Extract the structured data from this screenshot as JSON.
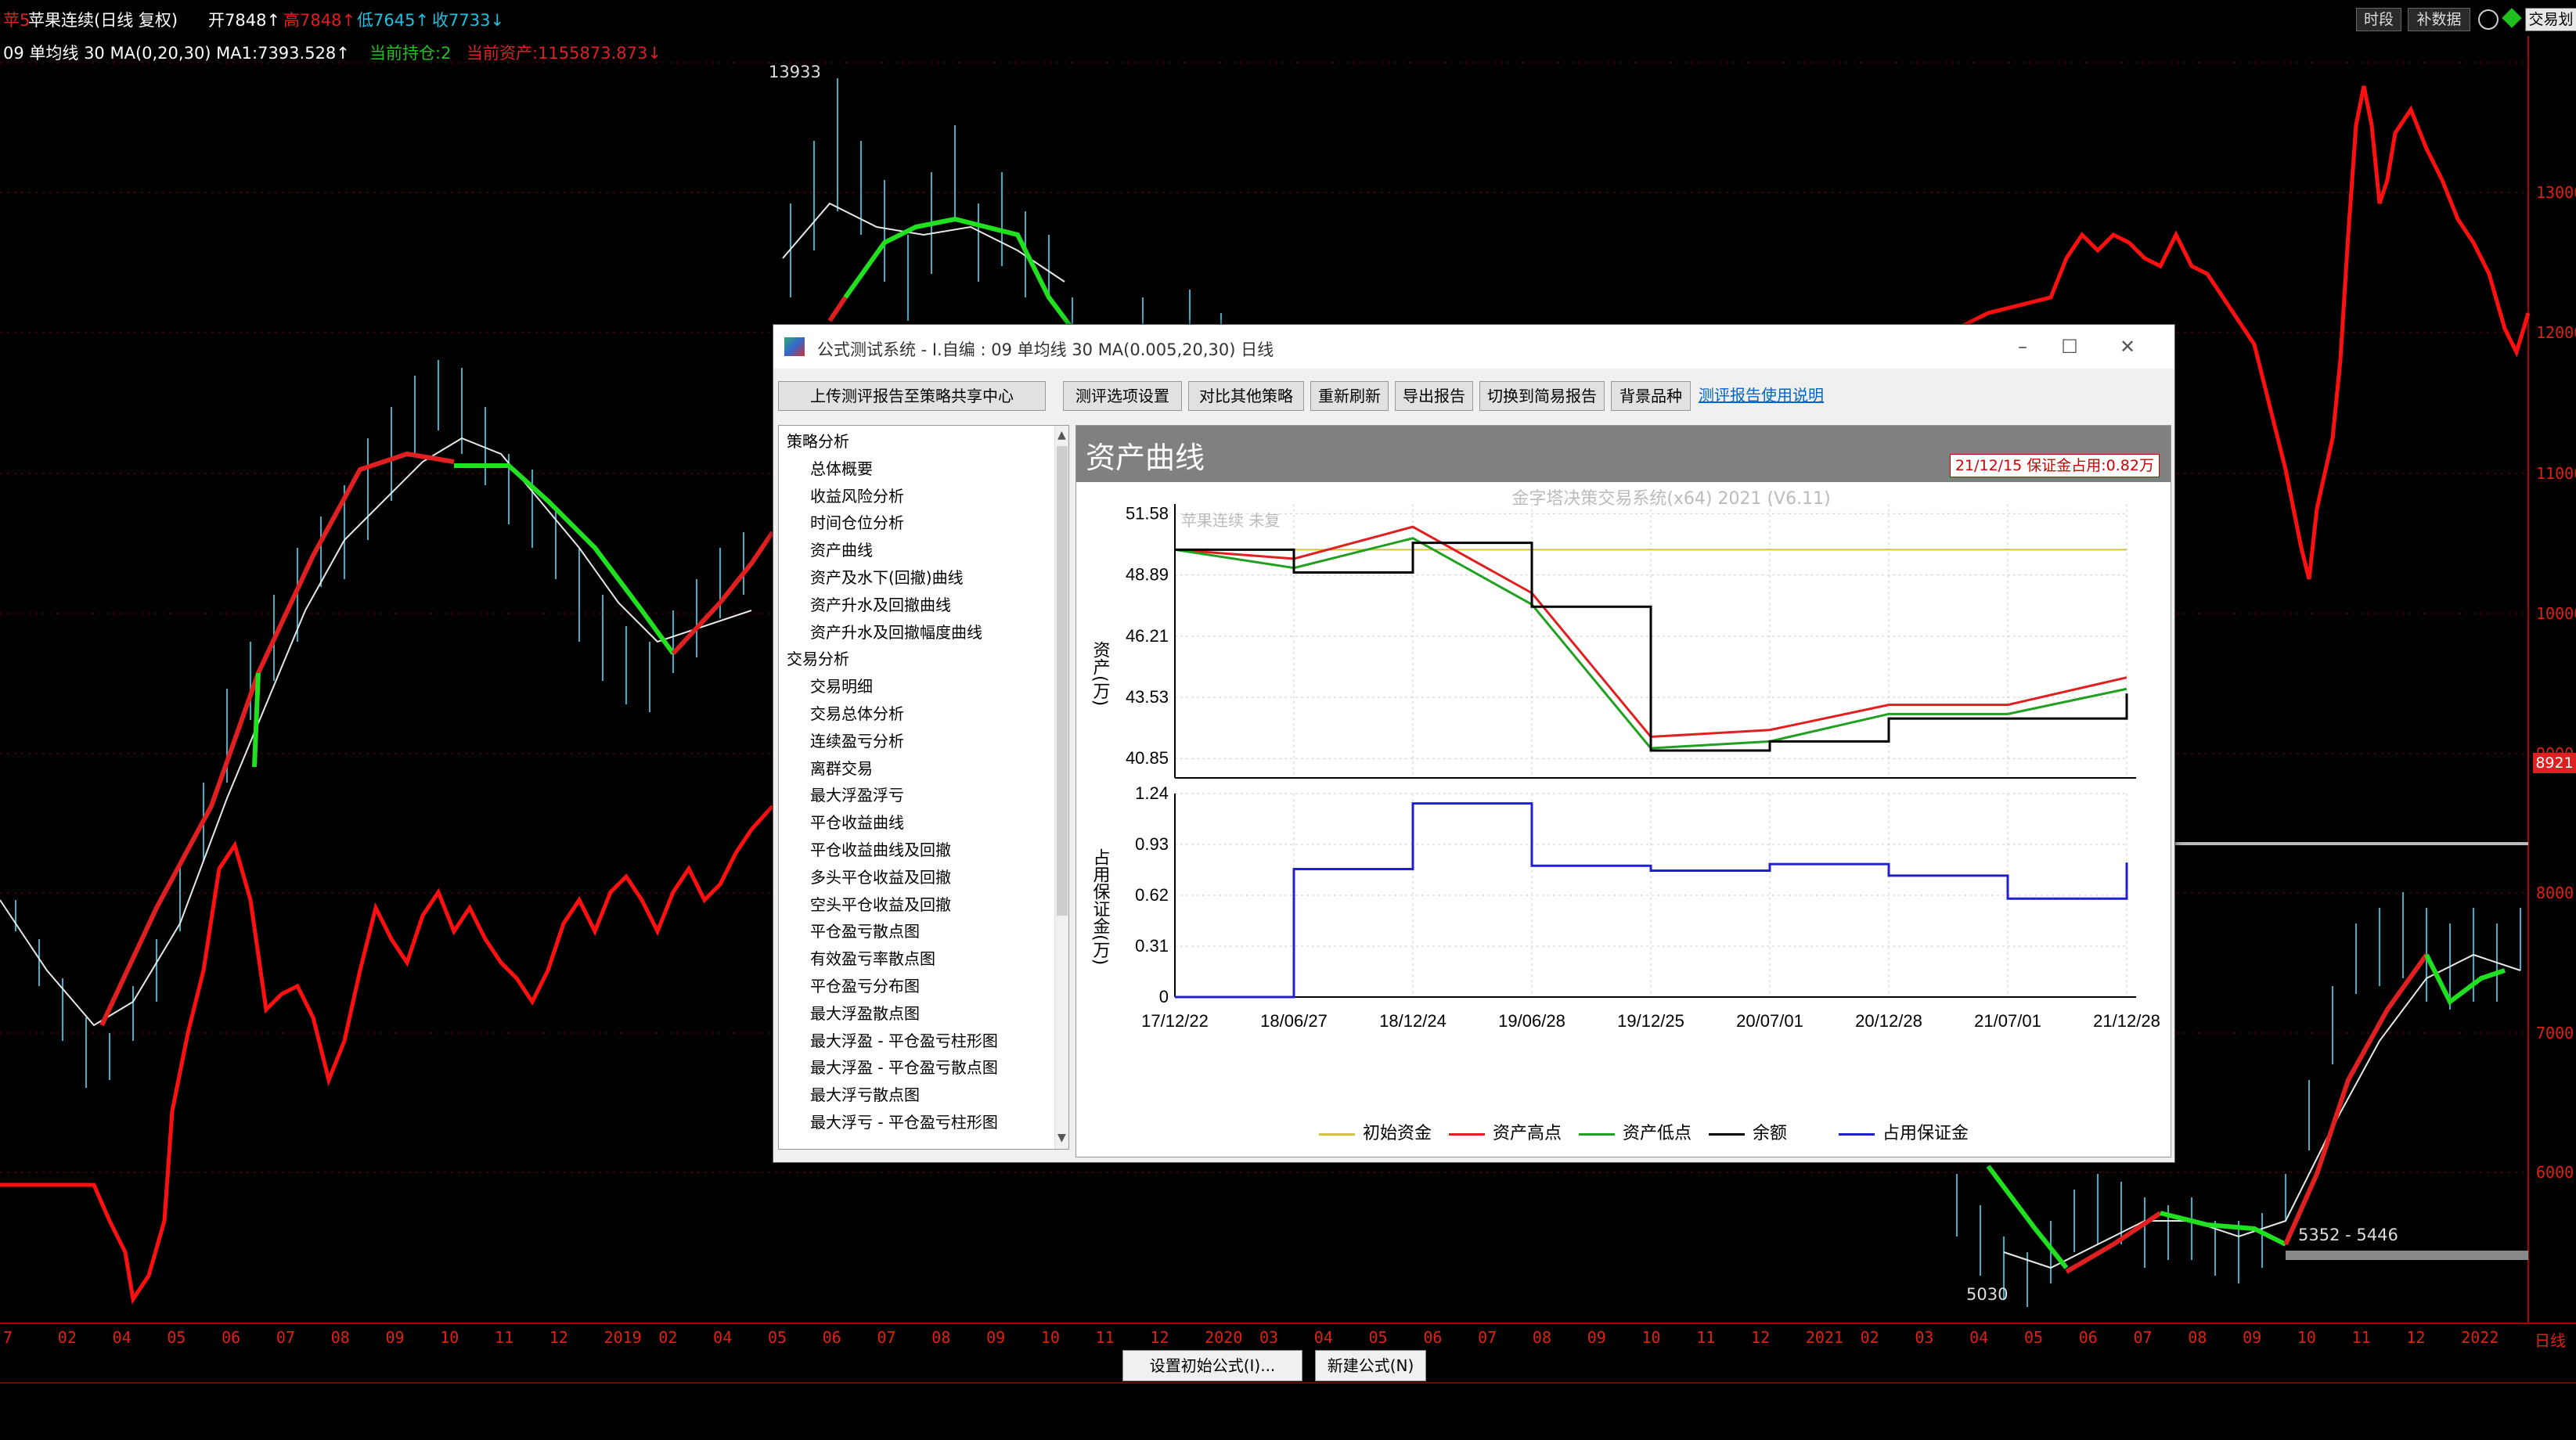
{
  "header": {
    "code": "苹5",
    "name": "苹果连续(日线 复权)",
    "open": "开7848↑",
    "high": "高7848↑",
    "low": "低7645↑",
    "close": "收7733↓",
    "btn_history": "时段",
    "btn_fill": "补数据",
    "btn_trade": "交易划"
  },
  "indicator_line": {
    "formula": "09 单均线 30 MA(0,20,30) MA1:7393.528↑",
    "position": "当前持仓:2",
    "assets": "当前资产:1155873.873↓"
  },
  "main_chart": {
    "high_label": "13933",
    "low_label": "5030",
    "range_label": "5352 - 5446",
    "last_price": "8921",
    "y_ticks": [
      "13000",
      "12000",
      "11000",
      "10000",
      "9000",
      "8000",
      "7000",
      "6000"
    ],
    "x_ticks": [
      "7",
      "02",
      "04",
      "05",
      "06",
      "07",
      "08",
      "09",
      "10",
      "11",
      "12",
      "2019",
      "02",
      "04",
      "05",
      "06",
      "07",
      "08",
      "09",
      "10",
      "11",
      "12",
      "2020",
      "03",
      "04",
      "05",
      "06",
      "07",
      "08",
      "09",
      "10",
      "11",
      "12",
      "2021",
      "02",
      "03",
      "04",
      "05",
      "06",
      "07",
      "08",
      "09",
      "10",
      "11",
      "12",
      "2022"
    ],
    "period": "日线"
  },
  "bottom": {
    "btn_set_initial": "设置初始公式(I)...",
    "btn_new_formula": "新建公式(N)"
  },
  "dialog": {
    "title": "公式测试系统 - I.自编 : 09 单均线 30 MA(0.005,20,30) 日线",
    "btn_upload": "上传测评报告至策略共享中心",
    "btn_options": "测评选项设置",
    "btn_compare": "对比其他策略",
    "btn_refresh": "重新刷新",
    "btn_export": "导出报告",
    "btn_simple": "切换到简易报告",
    "btn_background": "背景品种",
    "link_help": "测评报告使用说明",
    "tree": [
      {
        "label": "策略分析",
        "level": 0
      },
      {
        "label": "总体概要",
        "level": 1
      },
      {
        "label": "收益风险分析",
        "level": 1
      },
      {
        "label": "时间仓位分析",
        "level": 1
      },
      {
        "label": "资产曲线",
        "level": 1
      },
      {
        "label": "资产及水下(回撤)曲线",
        "level": 1
      },
      {
        "label": "资产升水及回撤曲线",
        "level": 1
      },
      {
        "label": "资产升水及回撤幅度曲线",
        "level": 1
      },
      {
        "label": "交易分析",
        "level": 0
      },
      {
        "label": "交易明细",
        "level": 1
      },
      {
        "label": "交易总体分析",
        "level": 1
      },
      {
        "label": "连续盈亏分析",
        "level": 1
      },
      {
        "label": "离群交易",
        "level": 1
      },
      {
        "label": "最大浮盈浮亏",
        "level": 1
      },
      {
        "label": "平仓收益曲线",
        "level": 1
      },
      {
        "label": "平仓收益曲线及回撤",
        "level": 1
      },
      {
        "label": "多头平仓收益及回撤",
        "level": 1
      },
      {
        "label": "空头平仓收益及回撤",
        "level": 1
      },
      {
        "label": "平仓盈亏散点图",
        "level": 1
      },
      {
        "label": "有效盈亏率散点图",
        "level": 1
      },
      {
        "label": "平仓盈亏分布图",
        "level": 1
      },
      {
        "label": "最大浮盈散点图",
        "level": 1
      },
      {
        "label": "最大浮盈 - 平仓盈亏柱形图",
        "level": 1
      },
      {
        "label": "最大浮盈 - 平仓盈亏散点图",
        "level": 1
      },
      {
        "label": "最大浮亏散点图",
        "level": 1
      },
      {
        "label": "最大浮亏 - 平仓盈亏柱形图",
        "level": 1
      }
    ],
    "panel_title": "资产曲线",
    "margin_badge": "21/12/15 保证金占用:0.82万",
    "watermark": "金字塔决策交易系统(x64) 2021 (V6.11)",
    "bg_symbol": "苹果连续 未复",
    "upper_ylabel": "资产(万)",
    "lower_ylabel": "占用保证金(万)",
    "legend": [
      {
        "label": "初始资金",
        "color": "#d8c040"
      },
      {
        "label": "资产高点",
        "color": "#e02020"
      },
      {
        "label": "资产低点",
        "color": "#20a020"
      },
      {
        "label": "余额",
        "color": "#000000"
      },
      {
        "label": "占用保证金",
        "color": "#2020d0"
      }
    ]
  },
  "chart_data": {
    "type": "line",
    "x": [
      "17/12/22",
      "18/06/27",
      "18/12/24",
      "19/06/28",
      "19/12/25",
      "20/07/01",
      "20/12/28",
      "21/07/01",
      "21/12/28"
    ],
    "upper": {
      "ylabel": "资产(万)",
      "y_ticks": [
        51.58,
        48.89,
        46.21,
        43.53,
        40.85
      ],
      "ylim": [
        40.0,
        52.0
      ],
      "series": [
        {
          "name": "初始资金",
          "values": [
            50.0,
            50.0,
            50.0,
            50.0,
            50.0,
            50.0,
            50.0,
            50.0,
            50.0
          ]
        },
        {
          "name": "资产高点",
          "values": [
            50.0,
            49.6,
            51.0,
            48.1,
            41.8,
            42.1,
            43.2,
            43.2,
            44.4
          ]
        },
        {
          "name": "资产低点",
          "values": [
            50.0,
            49.2,
            50.5,
            47.6,
            41.3,
            41.6,
            42.8,
            42.8,
            43.9
          ]
        },
        {
          "name": "余额",
          "values": [
            50.0,
            49.0,
            50.3,
            47.5,
            41.2,
            41.6,
            42.6,
            42.6,
            43.7
          ]
        }
      ]
    },
    "lower": {
      "ylabel": "占用保证金(万)",
      "y_ticks": [
        1.24,
        0.93,
        0.62,
        0.31,
        0.0
      ],
      "ylim": [
        0.0,
        1.24
      ],
      "series": [
        {
          "name": "占用保证金",
          "values": [
            0.0,
            0.78,
            1.18,
            0.8,
            0.77,
            0.81,
            0.74,
            0.6,
            0.82
          ]
        }
      ]
    }
  }
}
